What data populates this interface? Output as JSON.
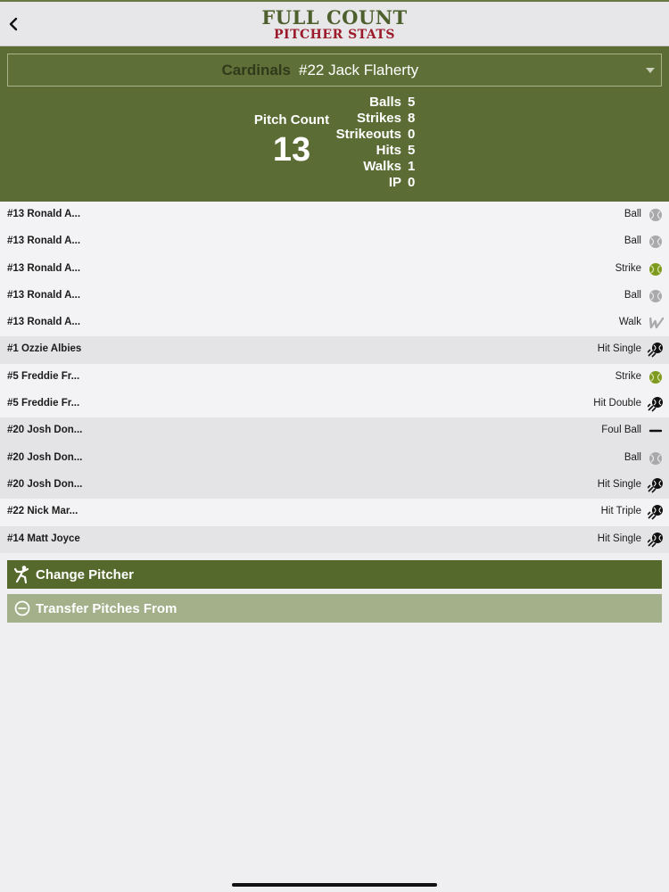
{
  "header": {
    "back_icon": "chevron-left-icon",
    "logo_line1": "FULL COUNT",
    "logo_line2": "PITCHER STATS",
    "colors": {
      "logo_green": "#4d5f2c",
      "logo_red": "#9b1b2a"
    }
  },
  "pitcher": {
    "team": "Cardinals",
    "player": "#22 Jack Flaherty"
  },
  "pitch_count": {
    "label": "Pitch Count",
    "value": "13"
  },
  "stats": [
    {
      "label": "Balls",
      "value": "5"
    },
    {
      "label": "Strikes",
      "value": "8"
    },
    {
      "label": "Strikeouts",
      "value": "0"
    },
    {
      "label": "Hits",
      "value": "5"
    },
    {
      "label": "Walks",
      "value": "1"
    },
    {
      "label": "IP",
      "value": "0"
    }
  ],
  "pitches": [
    {
      "batter": "#13 Ronald A...",
      "result": "Ball",
      "icon": "ball-icon",
      "shade": false
    },
    {
      "batter": "#13 Ronald A...",
      "result": "Ball",
      "icon": "ball-icon",
      "shade": false
    },
    {
      "batter": "#13 Ronald A...",
      "result": "Strike",
      "icon": "strike-icon",
      "shade": false
    },
    {
      "batter": "#13 Ronald A...",
      "result": "Ball",
      "icon": "ball-icon",
      "shade": false
    },
    {
      "batter": "#13 Ronald A...",
      "result": "Walk",
      "icon": "walk-icon",
      "shade": false
    },
    {
      "batter": "#1 Ozzie Albies",
      "result": "Hit Single",
      "icon": "hit-icon",
      "shade": true
    },
    {
      "batter": "#5 Freddie Fr...",
      "result": "Strike",
      "icon": "strike-icon",
      "shade": false
    },
    {
      "batter": "#5 Freddie Fr...",
      "result": "Hit Double",
      "icon": "hit-icon",
      "shade": false
    },
    {
      "batter": "#20 Josh Don...",
      "result": "Foul Ball",
      "icon": "foul-ball-icon",
      "shade": true
    },
    {
      "batter": "#20 Josh Don...",
      "result": "Ball",
      "icon": "ball-icon",
      "shade": true
    },
    {
      "batter": "#20 Josh Don...",
      "result": "Hit Single",
      "icon": "hit-icon",
      "shade": true
    },
    {
      "batter": "#22 Nick Mar...",
      "result": "Hit Triple",
      "icon": "hit-icon",
      "shade": false
    },
    {
      "batter": "#14 Matt Joyce",
      "result": "Hit Single",
      "icon": "hit-icon",
      "shade": true
    }
  ],
  "actions": {
    "change_pitcher": {
      "label": "Change Pitcher",
      "icon": "pitcher-throwing-icon"
    },
    "transfer_pitches": {
      "label": "Transfer Pitches From",
      "icon": "minus-circle-icon"
    }
  },
  "colors": {
    "panel_green": "#5b6d35",
    "button_green": "#56692d",
    "button_light_green": "#a3b08a",
    "strike_green": "#7f9b1f",
    "ball_gray": "#a9a9ab"
  }
}
